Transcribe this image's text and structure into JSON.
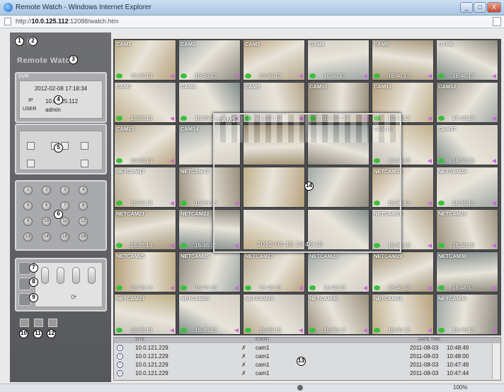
{
  "window": {
    "title": "Remote Watch - Windows Internet Explorer",
    "url_prefix": "http://",
    "url_host": "10.0.125.112",
    "url_rest": ":12088/watch.htm",
    "min_label": "_",
    "max_label": "□",
    "close_label": "X"
  },
  "app": {
    "logo": "Remote Watch"
  },
  "dvr": {
    "header": "DVR",
    "datetime": "2012-02-08 17:18:34",
    "ip_label": "IP",
    "ip_value": "10.0.125.112",
    "user_label": "USER",
    "user_value": "admin"
  },
  "channels": [
    "1",
    "2",
    "3",
    "4",
    "5",
    "6",
    "7",
    "8",
    "9",
    "10",
    "11",
    "12",
    "13",
    "14",
    "15",
    "16"
  ],
  "cameras": [
    {
      "name": "CAM1",
      "time": "16:46:13"
    },
    {
      "name": "CAM2",
      "time": "16:46:13"
    },
    {
      "name": "CAM3",
      "time": "16:46:13"
    },
    {
      "name": "CAM4",
      "time": "16:46:13"
    },
    {
      "name": "CAM5",
      "time": "16:46:13"
    },
    {
      "name": "CAM6",
      "time": "16:46:13"
    },
    {
      "name": "CAM7",
      "time": "16:46:13"
    },
    {
      "name": "CAM8",
      "time": "16:46:13"
    },
    {
      "name": "CAM9",
      "time": "16:46:13"
    },
    {
      "name": "CAM10",
      "time": "16:46:13"
    },
    {
      "name": "CAM11",
      "time": "16:46:13"
    },
    {
      "name": "CAM12",
      "time": "16:46:13"
    },
    {
      "name": "CAM13",
      "time": "16:46:13"
    },
    {
      "name": "CAM14",
      "time": ""
    },
    {
      "name": "",
      "time": ""
    },
    {
      "name": "",
      "time": ""
    },
    {
      "name": "CAM15",
      "time": "16:46:13"
    },
    {
      "name": "CAM17",
      "time": "16:46:13"
    },
    {
      "name": "NETCAM17",
      "time": "16:46:13"
    },
    {
      "name": "NETCAM17",
      "time": "16:46:13"
    },
    {
      "name": "",
      "time": ""
    },
    {
      "name": "",
      "time": ""
    },
    {
      "name": "NETCAM23",
      "time": "16:46:13"
    },
    {
      "name": "NETCAM24",
      "time": "16:46:13"
    },
    {
      "name": "NETCAM21",
      "time": "16:46:13"
    },
    {
      "name": "NETCAM22",
      "time": "16:46:13"
    },
    {
      "name": "",
      "time": ""
    },
    {
      "name": "",
      "time": ""
    },
    {
      "name": "NETCAM25",
      "time": "16:46:13"
    },
    {
      "name": "NETCAM26",
      "time": "16:46:13"
    },
    {
      "name": "NETCAM25",
      "time": "16:46:13"
    },
    {
      "name": "NETCAM26",
      "time": "16:46:13"
    },
    {
      "name": "NETCAM27",
      "time": "16:46:13"
    },
    {
      "name": "NETCAM28",
      "time": "16:46:13"
    },
    {
      "name": "NETCAM29",
      "time": "16:46:13"
    },
    {
      "name": "NETCAM30",
      "time": "16:46:13"
    },
    {
      "name": "NETCAM27",
      "time": "16:46:13"
    },
    {
      "name": "NETCAM28",
      "time": "16:46:13"
    },
    {
      "name": "NETCAM29",
      "time": "16:46:13"
    },
    {
      "name": "NETCAM30",
      "time": "16:46:13"
    },
    {
      "name": "NETCAM31",
      "time": "16:46:13"
    },
    {
      "name": "NETCAM32",
      "time": "16:46:13"
    }
  ],
  "bigcam": {
    "name": "CAM1",
    "time": "2012-04-18 16:46:13"
  },
  "log": {
    "headers": [
      "SITE",
      "",
      "EVENT",
      "",
      "DATE TIME"
    ],
    "rows": [
      {
        "icon": "i",
        "ip": "10.0.121.229",
        "cam": "cam1",
        "date": "2011-08-03",
        "time": "10:48:49"
      },
      {
        "icon": "i",
        "ip": "10.0.121.229",
        "cam": "cam1",
        "date": "2011-08-03",
        "time": "10:48:00"
      },
      {
        "icon": "i",
        "ip": "10.0.121.229",
        "cam": "cam1",
        "date": "2011-08-03",
        "time": "10:47:49"
      },
      {
        "icon": "i",
        "ip": "10.0.121.229",
        "cam": "cam1",
        "date": "2011-08-03",
        "time": "10:47:44"
      }
    ]
  },
  "callouts": [
    "1",
    "2",
    "3",
    "4",
    "5",
    "6",
    "7",
    "8",
    "9",
    "10",
    "11",
    "12",
    "13",
    "14"
  ],
  "status": {
    "zoom": "100%"
  },
  "colors": {
    "panel": "#5f6064",
    "accent_green": "#3bbf3b",
    "speaker": "#c86ad6"
  }
}
